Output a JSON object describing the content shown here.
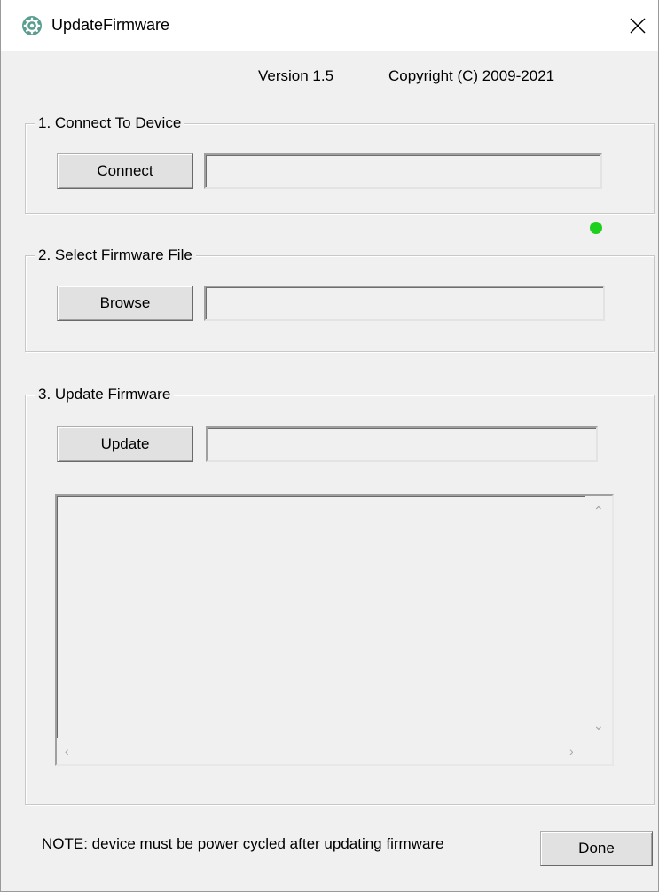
{
  "window": {
    "title": "UpdateFirmware",
    "icon": "gear-icon",
    "close_icon": "close-icon"
  },
  "header": {
    "version": "Version 1.5",
    "copyright": "Copyright (C) 2009-2021"
  },
  "connect_group": {
    "legend": "1. Connect To Device",
    "button_label": "Connect",
    "field_value": "",
    "status_led_color": "#1ed01e"
  },
  "browse_group": {
    "legend": "2. Select Firmware File",
    "button_label": "Browse",
    "field_value": ""
  },
  "update_group": {
    "legend": "3. Update Firmware",
    "button_label": "Update",
    "field_value": "",
    "log_text": ""
  },
  "footer": {
    "note": "NOTE:  device must be power cycled after updating firmware",
    "done_label": "Done"
  }
}
